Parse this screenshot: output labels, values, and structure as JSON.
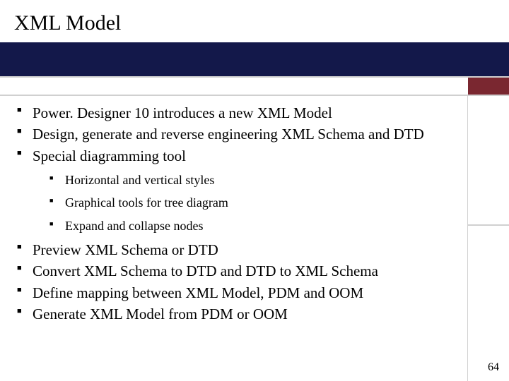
{
  "title": "XML Model",
  "bullets": {
    "b0": "Power. Designer 10 introduces a new XML Model",
    "b1": "Design, generate and reverse engineering XML Schema and DTD",
    "b2": "Special diagramming tool",
    "b2_sub": {
      "s0": "Horizontal and vertical styles",
      "s1": "Graphical tools for tree diagram",
      "s2": "Expand and collapse nodes"
    },
    "b3": "Preview XML Schema or DTD",
    "b4": "Convert XML Schema to DTD and DTD to XML Schema",
    "b5": "Define mapping between XML Model, PDM and OOM",
    "b6": "Generate XML Model from PDM or OOM"
  },
  "page_number": "64",
  "colors": {
    "navy": "#13184a",
    "maroon": "#7a2730",
    "divider": "#d0d0d0"
  }
}
